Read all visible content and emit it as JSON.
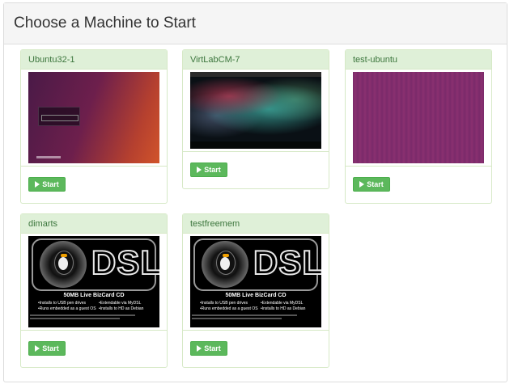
{
  "panel": {
    "title": "Choose a Machine to Start"
  },
  "machines": [
    {
      "name": "Ubuntu32-1",
      "start_label": "Start"
    },
    {
      "name": "VirtLabCM-7",
      "start_label": "Start"
    },
    {
      "name": "test-ubuntu",
      "start_label": "Start"
    },
    {
      "name": "dimarts",
      "start_label": "Start"
    },
    {
      "name": "testfreemem",
      "start_label": "Start"
    }
  ],
  "dsl_screen": {
    "logo": "DSL",
    "tagline": "50MB Live BizCard CD",
    "features": [
      "Installs to USB pen drives",
      "Extendable via MyDSL",
      "Runs embedded as a guest OS",
      "Installs to HD as Debian"
    ]
  },
  "colors": {
    "card_header": "#dff0d8",
    "card_border": "#d6e9c6",
    "title_text": "#3c763d",
    "start_button": "#5cb85c"
  }
}
